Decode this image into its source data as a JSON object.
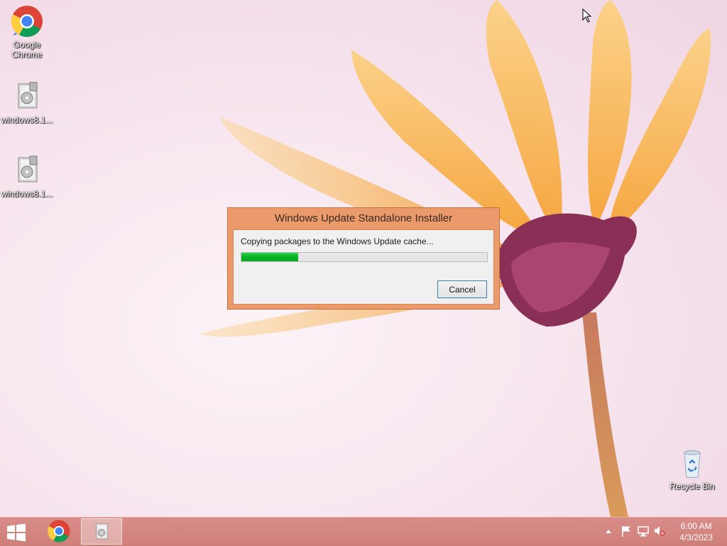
{
  "desktop": {
    "icons": [
      {
        "label": "Google Chrome"
      },
      {
        "label": "windows8.1..."
      },
      {
        "label": "windows8.1..."
      },
      {
        "label": "Recycle Bin"
      }
    ]
  },
  "dialog": {
    "title": "Windows Update Standalone Installer",
    "message": "Copying packages to the Windows Update cache...",
    "progress_fraction": 0.23,
    "cancel_label": "Cancel"
  },
  "taskbar": {
    "items": [
      {
        "name": "start",
        "icon": "windows-logo-icon"
      },
      {
        "name": "chrome",
        "icon": "chrome-icon"
      },
      {
        "name": "installer",
        "icon": "installer-icon",
        "active": true
      }
    ],
    "tray_icons": [
      "show-hidden-icons",
      "action-center-flag-icon",
      "network-icon",
      "volume-muted-icon"
    ],
    "time": "6:00 AM",
    "date": "4/3/2023"
  },
  "colors": {
    "dialog_frame": "#eb9a6b",
    "taskbar": "#d98d88",
    "progress_fill": "#06b025"
  }
}
